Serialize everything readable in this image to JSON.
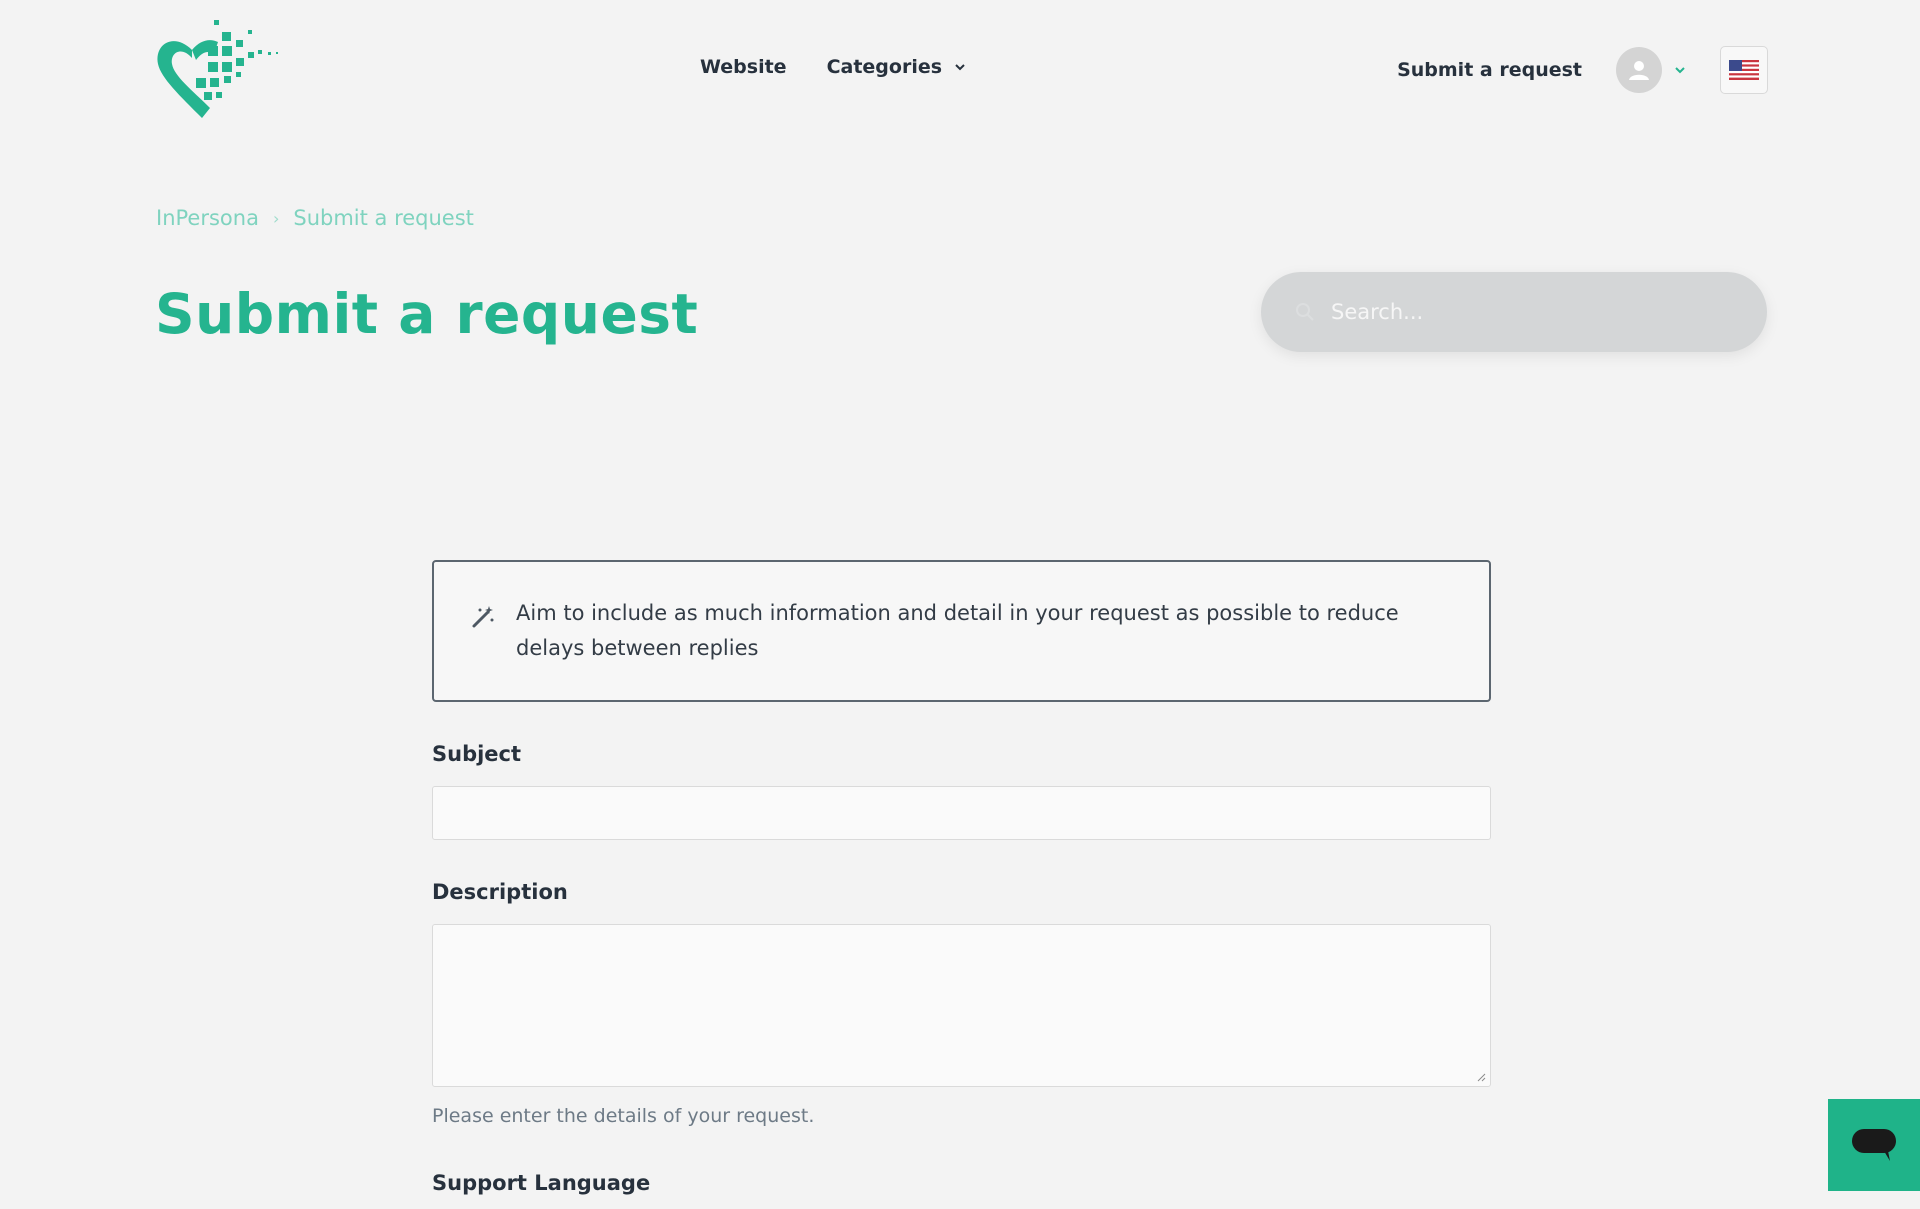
{
  "header": {
    "logo_name": "InPersona heart logo",
    "nav": [
      {
        "label": "Website"
      },
      {
        "label": "Categories"
      }
    ],
    "submit_label": "Submit a request",
    "flag_icon": "us-flag-icon"
  },
  "breadcrumb": {
    "items": [
      "InPersona",
      "Submit a request"
    ],
    "separator": "›"
  },
  "title": "Submit a request",
  "search": {
    "placeholder": "Search..."
  },
  "form": {
    "notice": "Aim to include as much information and detail in your request as possible to reduce delays between replies",
    "subject_label": "Subject",
    "subject_value": "",
    "description_label": "Description",
    "description_value": "",
    "description_hint": "Please enter the details of your request.",
    "language_label": "Support Language"
  },
  "colors": {
    "brand": "#25b48f",
    "breadcrumb": "#7fd3bf",
    "chat": "#1fb389"
  }
}
